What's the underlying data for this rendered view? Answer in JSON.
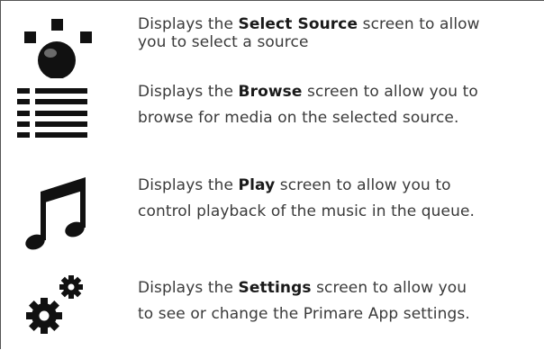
{
  "rows": [
    {
      "icon": "select-source-icon",
      "line1_before": "Displays the ",
      "keyword": "Select Source",
      "line1_after": " screen to allow",
      "line2": "you to select a source"
    },
    {
      "icon": "browse-list-icon",
      "line1_before": "Displays the ",
      "keyword": "Browse",
      "line1_after": " screen to allow you to",
      "line2": "browse for media on the selected source."
    },
    {
      "icon": "music-note-icon",
      "line1_before": "Displays the ",
      "keyword": "Play",
      "line1_after": " screen to allow you to",
      "line2": "control playback of the music in the queue."
    },
    {
      "icon": "settings-gears-icon",
      "line1_before": "Displays the ",
      "keyword": "Settings",
      "line1_after": " screen to allow you",
      "line2": "to see or change the Primare App settings."
    }
  ],
  "colors": {
    "text": "#3a3a3a",
    "bold_text": "#1a1a1a",
    "icon": "#111111",
    "border": "#555555"
  }
}
